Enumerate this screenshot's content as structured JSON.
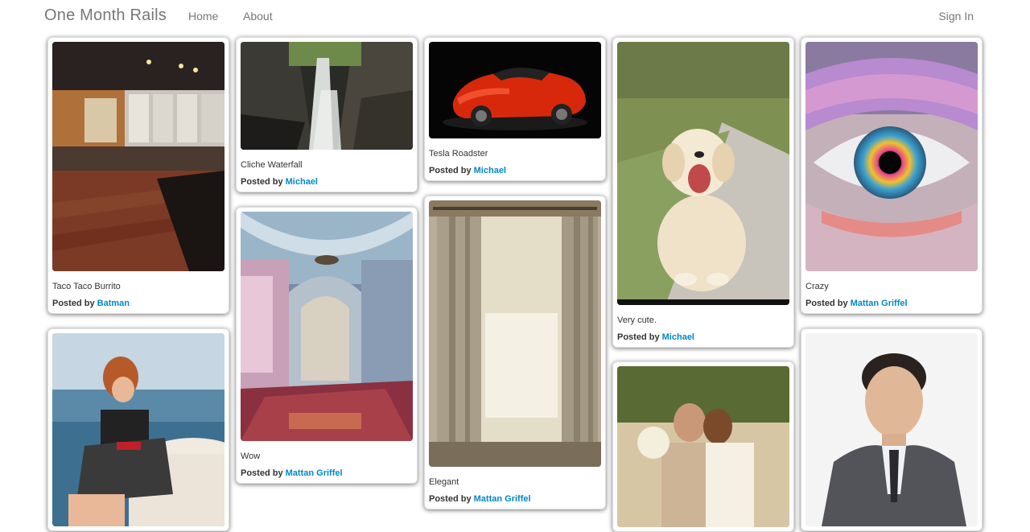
{
  "nav": {
    "brand": "One Month Rails",
    "home": "Home",
    "about": "About",
    "sign_in": "Sign In"
  },
  "posted_by_label": "Posted by",
  "pins": [
    {
      "description": "Taco Taco Burrito",
      "author": "Batman",
      "image": "restaurant-interior-photo"
    },
    {
      "description": "Cliche Waterfall",
      "author": "Michael",
      "image": "waterfall-gorge-photo"
    },
    {
      "description": "Tesla Roadster",
      "author": "Michael",
      "image": "red-sports-car-photo"
    },
    {
      "description": "Very cute.",
      "author": "Michael",
      "image": "puppy-photo"
    },
    {
      "description": "Crazy",
      "author": "Mattan Griffel",
      "image": "colorful-eye-makeup-photo"
    },
    {
      "description": "",
      "author": "",
      "image": "woman-on-car-photo"
    },
    {
      "description": "Wow",
      "author": "Mattan Griffel",
      "image": "mosque-interior-photo"
    },
    {
      "description": "Elegant",
      "author": "Mattan Griffel",
      "image": "ruffled-curtains-photo"
    },
    {
      "description": "",
      "author": "",
      "image": "wedding-couple-photo"
    },
    {
      "description": "",
      "author": "",
      "image": "man-in-suit-portrait-photo"
    }
  ]
}
